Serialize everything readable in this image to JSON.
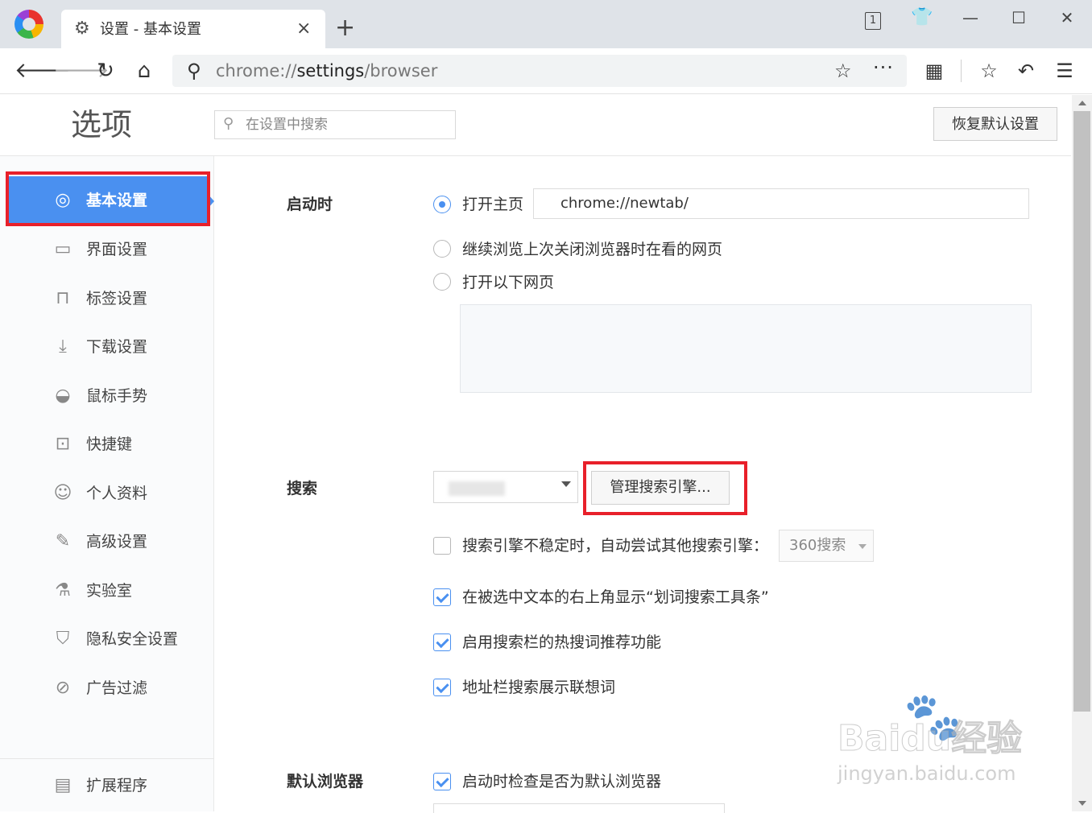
{
  "window": {
    "tab_icon": "gear-icon",
    "tab_title": "设置 - 基本设置",
    "tab_close": "×",
    "new_tab": "+",
    "tab_count": "1",
    "minimize": "—",
    "maximize": "☐",
    "close": "✕"
  },
  "toolbar": {
    "url_scheme": "chrome://",
    "url_host": "settings",
    "url_path": "/browser"
  },
  "header": {
    "title": "选项",
    "search_placeholder": "在设置中搜索",
    "restore_button": "恢复默认设置"
  },
  "sidebar": {
    "items": [
      {
        "label": "基本设置",
        "icon": "target-icon",
        "active": true
      },
      {
        "label": "界面设置",
        "icon": "window-icon"
      },
      {
        "label": "标签设置",
        "icon": "tab-icon"
      },
      {
        "label": "下载设置",
        "icon": "download-icon"
      },
      {
        "label": "鼠标手势",
        "icon": "mouse-icon"
      },
      {
        "label": "快捷键",
        "icon": "shortcut-icon"
      },
      {
        "label": "个人资料",
        "icon": "user-icon"
      },
      {
        "label": "高级设置",
        "icon": "wrench-icon"
      },
      {
        "label": "实验室",
        "icon": "flask-icon"
      },
      {
        "label": "隐私安全设置",
        "icon": "shield-icon"
      },
      {
        "label": "广告过滤",
        "icon": "block-icon"
      }
    ],
    "extensions": {
      "label": "扩展程序",
      "icon": "extensions-icon"
    }
  },
  "startup": {
    "label": "启动时",
    "option_home": "打开主页",
    "home_url": "chrome://newtab/",
    "option_continue": "继续浏览上次关闭浏览器时在看的网页",
    "option_pages": "打开以下网页"
  },
  "search": {
    "label": "搜索",
    "manage_button": "管理搜索引擎...",
    "fallback_label": "搜索引擎不稳定时，自动尝试其他搜索引擎：",
    "fallback_engine": "360搜索",
    "option_word_toolbar": "在被选中文本的右上角显示“划词搜索工具条”",
    "option_hot_words": "启用搜索栏的热搜词推荐功能",
    "option_suggest": "地址栏搜索展示联想词"
  },
  "default_browser": {
    "label": "默认浏览器",
    "option_check": "启动时检查是否为默认浏览器"
  },
  "watermark": {
    "brand": "Baidu经验",
    "domain": "jingyan.baidu.com"
  },
  "colors": {
    "accent": "#4a90f0",
    "highlight_red": "#e8202a",
    "sidebar_bg": "#fafbfc"
  }
}
